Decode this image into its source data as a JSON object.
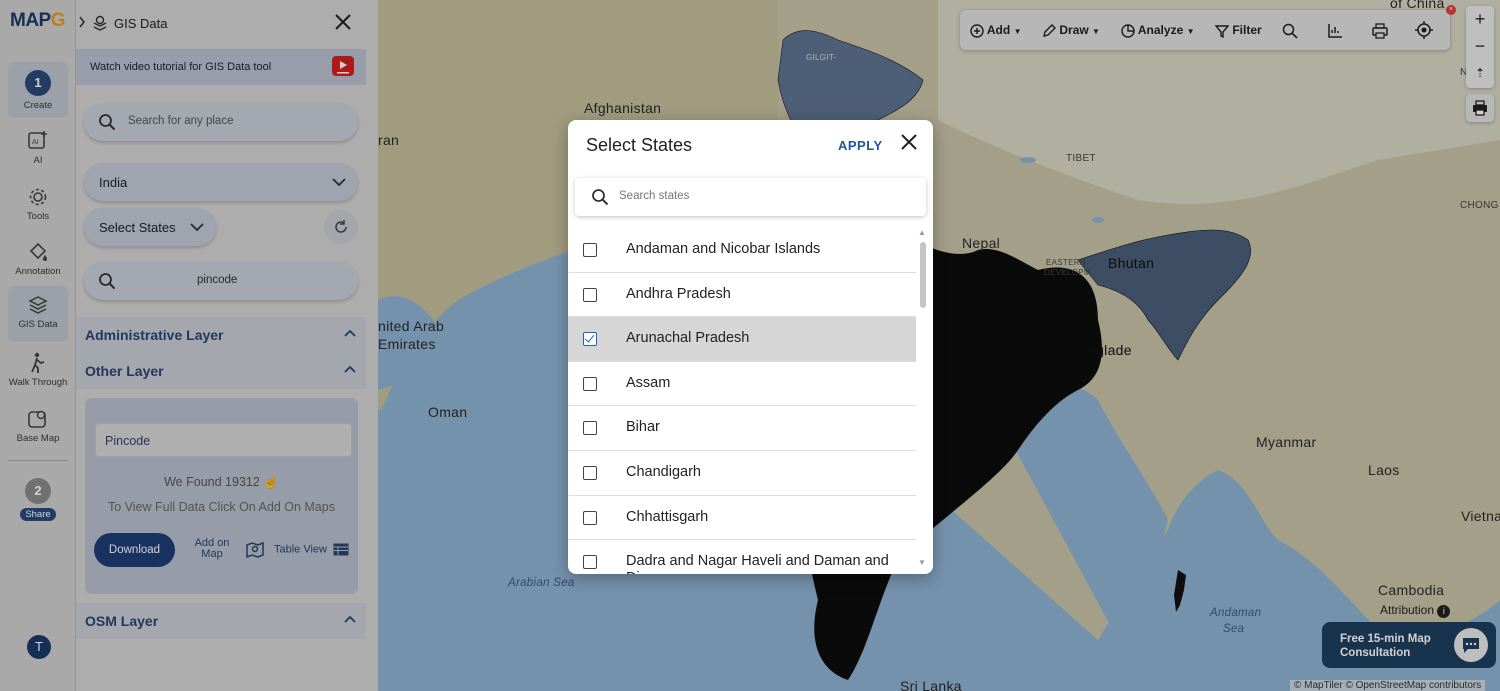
{
  "app": {
    "logo_prefix": "MAP",
    "logo_g": "G",
    "logo_suffix": "",
    "logo_text": "MAPOG"
  },
  "rail": {
    "create": {
      "step": "1",
      "label": "Create"
    },
    "items": [
      {
        "label": "AI",
        "icon": "ai-icon"
      },
      {
        "label": "Tools",
        "icon": "gear-icon"
      },
      {
        "label": "Annotation",
        "icon": "paint-bucket-icon"
      },
      {
        "label": "GIS Data",
        "icon": "layers-icon"
      },
      {
        "label": "Walk Through",
        "icon": "walk-icon"
      },
      {
        "label": "Base Map",
        "icon": "base-map-icon"
      }
    ],
    "share": {
      "step": "2",
      "label": "Share"
    },
    "avatar": "T"
  },
  "panel": {
    "title": "GIS Data",
    "video_text": "Watch video tutorial for GIS Data tool",
    "search_placeholder": "Search for any place",
    "country": "India",
    "states_label": "Select States",
    "pincode_placeholder": "pincode",
    "sections": {
      "administrative": "Administrative Layer",
      "other": "Other Layer",
      "osm": "OSM Layer"
    },
    "pincode_box": {
      "input_value": "Pincode",
      "found_prefix": "We Found",
      "found_count": "19312",
      "note": "To View Full Data Click On Add On Maps",
      "download": "Download",
      "add_on_map_1": "Add on",
      "add_on_map_2": "Map",
      "table_view": "Table View"
    }
  },
  "map": {
    "labels": {
      "afghanistan": "Afghanistan",
      "iran": "ran",
      "tibet": "TIBET",
      "nepal": "Nepal",
      "bhutan": "Bhutan",
      "uae_1": "nited Arab",
      "uae_2": "Emirates",
      "oman": "Oman",
      "myanmar": "Myanmar",
      "laos": "Laos",
      "vietnam": "Vietna",
      "cambodia": "Cambodia",
      "bangladesh": "nglade",
      "srilanka": "Sri Lanka",
      "arabian_sea": "Arabian Sea",
      "andaman_sea_1": "Andaman",
      "andaman_sea_2": "Sea",
      "china": "of China",
      "ningx": "NINGX",
      "chong": "CHONG",
      "gilgit": "GILGIT-",
      "eastern": "EASTERN",
      "develop": "DEVELOPM"
    },
    "toolbar": {
      "add": "Add",
      "draw": "Draw",
      "analyze": "Analyze",
      "filter": "Filter"
    },
    "attribution": "Attribution",
    "copyright": "© MapTiler © OpenStreetMap contributors",
    "consult": "Free 15-min Map Consultation"
  },
  "modal": {
    "title": "Select States",
    "apply": "APPLY",
    "search_placeholder": "Search states",
    "states": [
      {
        "name": "Andaman and Nicobar Islands",
        "checked": false
      },
      {
        "name": "Andhra Pradesh",
        "checked": false
      },
      {
        "name": "Arunachal Pradesh",
        "checked": true
      },
      {
        "name": "Assam",
        "checked": false
      },
      {
        "name": "Bihar",
        "checked": false
      },
      {
        "name": "Chandigarh",
        "checked": false
      },
      {
        "name": "Chhattisgarh",
        "checked": false
      },
      {
        "name": "Dadra and Nagar Haveli and Daman and Diu",
        "checked": false
      }
    ]
  },
  "colors": {
    "brand_dark": "#1d3a6b",
    "accent": "#e59b1a",
    "apply": "#1d55a8",
    "check": "#1a64c8"
  }
}
